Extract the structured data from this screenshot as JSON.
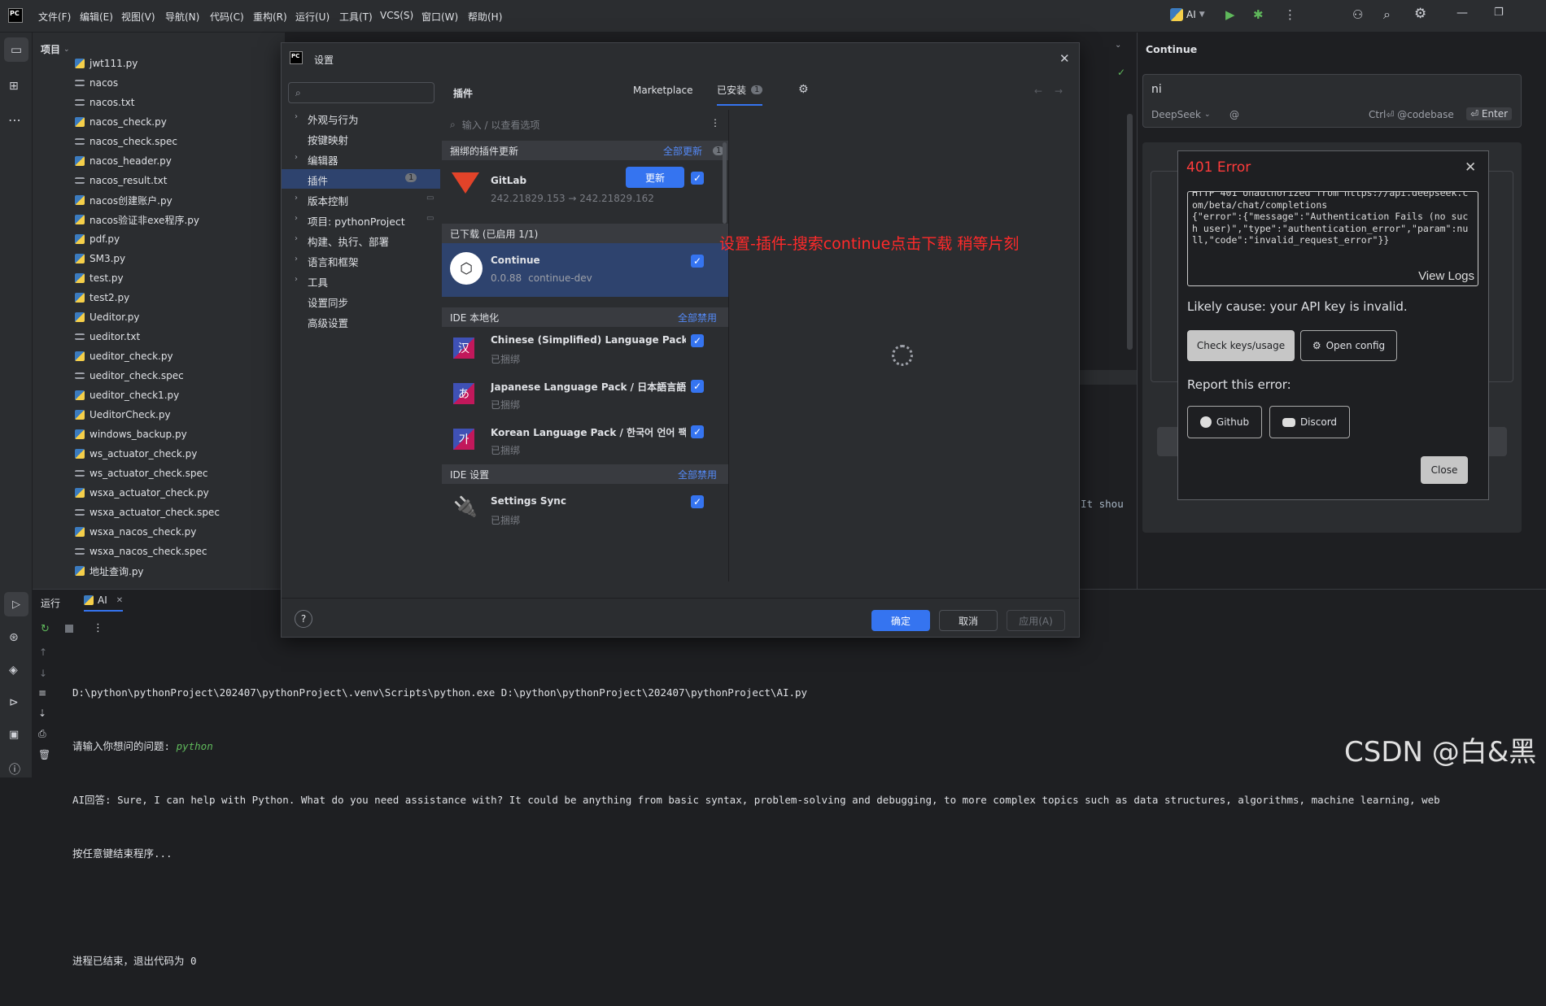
{
  "menubar": {
    "items": [
      "文件(F)",
      "编辑(E)",
      "视图(V)",
      "导航(N)",
      "代码(C)",
      "重构(R)",
      "运行(U)",
      "工具(T)",
      "VCS(S)",
      "窗口(W)",
      "帮助(H)"
    ],
    "run_config": "AI"
  },
  "project": {
    "title": "项目",
    "files": [
      {
        "name": "jwt111.py",
        "type": "py"
      },
      {
        "name": "nacos",
        "type": "txt"
      },
      {
        "name": "nacos.txt",
        "type": "txt"
      },
      {
        "name": "nacos_check.py",
        "type": "py"
      },
      {
        "name": "nacos_check.spec",
        "type": "txt"
      },
      {
        "name": "nacos_header.py",
        "type": "py"
      },
      {
        "name": "nacos_result.txt",
        "type": "txt"
      },
      {
        "name": "nacos创建账户.py",
        "type": "py"
      },
      {
        "name": "nacos验证非exe程序.py",
        "type": "py"
      },
      {
        "name": "pdf.py",
        "type": "py"
      },
      {
        "name": "SM3.py",
        "type": "py"
      },
      {
        "name": "test.py",
        "type": "py"
      },
      {
        "name": "test2.py",
        "type": "py"
      },
      {
        "name": "Ueditor.py",
        "type": "py"
      },
      {
        "name": "ueditor.txt",
        "type": "txt"
      },
      {
        "name": "ueditor_check.py",
        "type": "py"
      },
      {
        "name": "ueditor_check.spec",
        "type": "txt"
      },
      {
        "name": "ueditor_check1.py",
        "type": "py"
      },
      {
        "name": "UeditorCheck.py",
        "type": "py"
      },
      {
        "name": "windows_backup.py",
        "type": "py"
      },
      {
        "name": "ws_actuator_check.py",
        "type": "py"
      },
      {
        "name": "ws_actuator_check.spec",
        "type": "txt"
      },
      {
        "name": "wsxa_actuator_check.py",
        "type": "py"
      },
      {
        "name": "wsxa_actuator_check.spec",
        "type": "txt"
      },
      {
        "name": "wsxa_nacos_check.py",
        "type": "py"
      },
      {
        "name": "wsxa_nacos_check.spec",
        "type": "txt"
      },
      {
        "name": "地址查询.py",
        "type": "py"
      }
    ]
  },
  "dialog": {
    "title": "设置",
    "search_placeholder": "",
    "nav": [
      {
        "label": "外观与行为",
        "chevron": true
      },
      {
        "label": "按键映射",
        "chevron": false
      },
      {
        "label": "编辑器",
        "chevron": true
      },
      {
        "label": "插件",
        "chevron": false,
        "badge": "1",
        "selected": true
      },
      {
        "label": "版本控制",
        "chevron": true,
        "pin": true
      },
      {
        "label": "项目: pythonProject",
        "chevron": true,
        "pin": true
      },
      {
        "label": "构建、执行、部署",
        "chevron": true
      },
      {
        "label": "语言和框架",
        "chevron": true
      },
      {
        "label": "工具",
        "chevron": true
      },
      {
        "label": "设置同步",
        "chevron": false
      },
      {
        "label": "高级设置",
        "chevron": false
      }
    ],
    "plugins_title": "插件",
    "tab_marketplace": "Marketplace",
    "tab_installed": "已安装",
    "installed_count": "1",
    "filter_placeholder": "输入 / 以查看选项",
    "sec_updates": "捆绑的插件更新",
    "sec_updates_action": "全部更新",
    "sec_updates_count": "1",
    "gitlab": {
      "name": "GitLab",
      "version": "242.21829.153 → 242.21829.162",
      "update": "更新"
    },
    "sec_downloaded": "已下载 (已启用 1/1)",
    "continue": {
      "name": "Continue",
      "version": "0.0.88",
      "vendor": "continue-dev"
    },
    "sec_locale": "IDE 本地化",
    "sec_locale_action": "全部禁用",
    "lang": [
      {
        "name": "Chinese (Simplified) Language Pack ...",
        "status": "已捆绑",
        "glyph": "汉"
      },
      {
        "name": "Japanese Language Pack / 日本語言語...",
        "status": "已捆绑",
        "glyph": "あ"
      },
      {
        "name": "Korean Language Pack / 한국어 언어 팩",
        "status": "已捆绑",
        "glyph": "가"
      }
    ],
    "sec_ide": "IDE 设置",
    "sec_ide_action": "全部禁用",
    "sync": {
      "name": "Settings Sync",
      "status": "已捆绑"
    },
    "ok": "确定",
    "cancel": "取消",
    "apply": "应用(A)",
    "help": "?"
  },
  "annotation": "设置-插件-搜索continue点击下载 稍等片刻",
  "continue_panel": {
    "title": "Continue",
    "input": "ni",
    "model": "DeepSeek",
    "shortcut": "Ctrl⏎ @codebase",
    "enter": "⏎ Enter",
    "error": {
      "title": "401 Error",
      "message": "HTTP 401 Unauthorized from https://api.deepseek.com/beta/chat/completions\n{\"error\":{\"message\":\"Authentication Fails (no such user)\",\"type\":\"authentication_error\",\"param\":null,\"code\":\"invalid_request_error\"}}",
      "view_logs": "View Logs",
      "cause": "Likely cause: your API key is invalid.",
      "check": "Check keys/usage",
      "open_config": "Open config",
      "report": "Report this error:",
      "github": "Github",
      "discord": "Discord",
      "close": "Close"
    }
  },
  "run": {
    "tab_run": "运行",
    "tab_ai": "AI",
    "lines": [
      "D:\\python\\pythonProject\\202407\\pythonProject\\.venv\\Scripts\\python.exe D:\\python\\pythonProject\\202407\\pythonProject\\AI.py",
      "请输入你想问的问题: ",
      "AI回答: Sure, I can help with Python. What do you need assistance with? It could be anything from basic syntax, problem-solving and debugging, to more complex topics such as data structures, algorithms, machine learning, web",
      "按任意键结束程序...",
      "",
      "进程已结束，退出代码为 0"
    ],
    "user_input": "python",
    "side_text": ". It shou"
  },
  "watermark": "CSDN @白&黑"
}
